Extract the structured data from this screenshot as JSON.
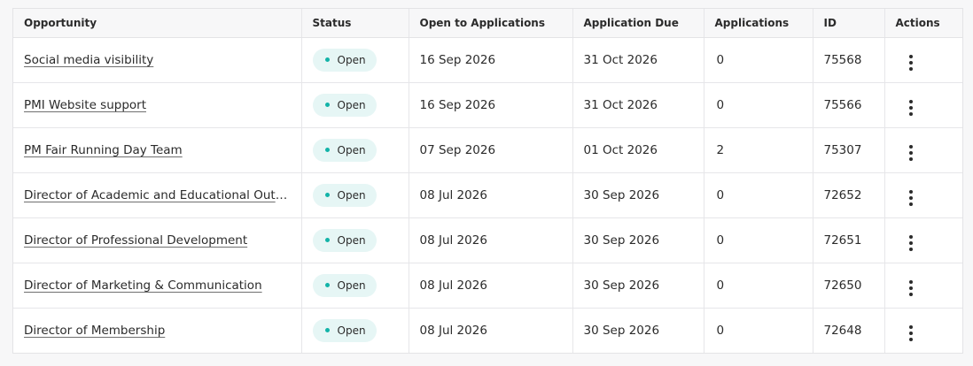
{
  "table": {
    "headers": {
      "opportunity": "Opportunity",
      "status": "Status",
      "open_to_applications": "Open to Applications",
      "application_due": "Application Due",
      "applications": "Applications",
      "id": "ID",
      "actions": "Actions"
    },
    "rows": [
      {
        "opportunity": "Social media visibility",
        "status": "Open",
        "open_to_applications": "16 Sep 2026",
        "application_due": "31 Oct 2026",
        "applications": "0",
        "id": "75568"
      },
      {
        "opportunity": "PMI Website support",
        "status": "Open",
        "open_to_applications": "16 Sep 2026",
        "application_due": "31 Oct 2026",
        "applications": "0",
        "id": "75566"
      },
      {
        "opportunity": "PM Fair Running Day Team",
        "status": "Open",
        "open_to_applications": "07 Sep 2026",
        "application_due": "01 Oct 2026",
        "applications": "2",
        "id": "75307"
      },
      {
        "opportunity": "Director of Academic and Educational Outre...",
        "status": "Open",
        "open_to_applications": "08 Jul 2026",
        "application_due": "30 Sep 2026",
        "applications": "0",
        "id": "72652"
      },
      {
        "opportunity": "Director of Professional Development",
        "status": "Open",
        "open_to_applications": "08 Jul 2026",
        "application_due": "30 Sep 2026",
        "applications": "0",
        "id": "72651"
      },
      {
        "opportunity": "Director of Marketing & Communication",
        "status": "Open",
        "open_to_applications": "08 Jul 2026",
        "application_due": "30 Sep 2026",
        "applications": "0",
        "id": "72650"
      },
      {
        "opportunity": "Director of Membership",
        "status": "Open",
        "open_to_applications": "08 Jul 2026",
        "application_due": "30 Sep 2026",
        "applications": "0",
        "id": "72648"
      }
    ]
  },
  "icons": {
    "actions": "more-vertical-icon",
    "status_dot": "status-dot-icon"
  },
  "colors": {
    "status_open_bg": "#e6f6f5",
    "status_open_dot": "#12b3a8",
    "header_bg": "#f7f7f8",
    "border": "#e6e6e9"
  }
}
